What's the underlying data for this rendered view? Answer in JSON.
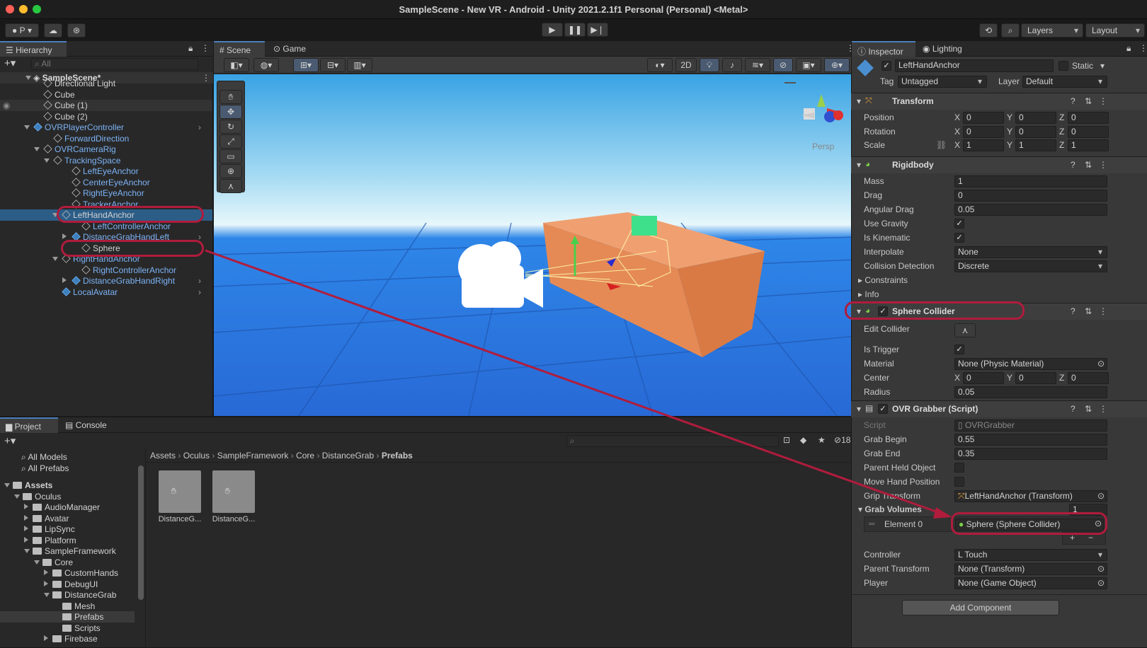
{
  "window": {
    "title": "SampleScene - New VR - Android - Unity 2021.2.1f1 Personal (Personal) <Metal>"
  },
  "toolbar": {
    "account": "P",
    "layers": "Layers",
    "layout": "Layout"
  },
  "hierarchy": {
    "tab": "Hierarchy",
    "search_placeholder": "All",
    "scene": "SampleScene*",
    "items": [
      {
        "label": "Directional Light"
      },
      {
        "label": "Cube"
      },
      {
        "label": "Cube (1)"
      },
      {
        "label": "Cube (2)"
      },
      {
        "label": "OVRPlayerController"
      },
      {
        "label": "ForwardDirection"
      },
      {
        "label": "OVRCameraRig"
      },
      {
        "label": "TrackingSpace"
      },
      {
        "label": "LeftEyeAnchor"
      },
      {
        "label": "CenterEyeAnchor"
      },
      {
        "label": "RightEyeAnchor"
      },
      {
        "label": "TrackerAnchor"
      },
      {
        "label": "LeftHandAnchor"
      },
      {
        "label": "LeftControllerAnchor"
      },
      {
        "label": "DistanceGrabHandLeft"
      },
      {
        "label": "Sphere"
      },
      {
        "label": "RightHandAnchor"
      },
      {
        "label": "RightControllerAnchor"
      },
      {
        "label": "DistanceGrabHandRight"
      },
      {
        "label": "LocalAvatar"
      }
    ]
  },
  "scene_view": {
    "tab_scene": "Scene",
    "tab_game": "Game",
    "mode_2d": "2D",
    "projection": "Persp"
  },
  "project": {
    "tab_project": "Project",
    "tab_console": "Console",
    "hidden_count": "18",
    "favorites": [
      "All Models",
      "All Prefabs"
    ],
    "tree": [
      {
        "label": "Assets"
      },
      {
        "label": "Oculus"
      },
      {
        "label": "AudioManager"
      },
      {
        "label": "Avatar"
      },
      {
        "label": "LipSync"
      },
      {
        "label": "Platform"
      },
      {
        "label": "SampleFramework"
      },
      {
        "label": "Core"
      },
      {
        "label": "CustomHands"
      },
      {
        "label": "DebugUI"
      },
      {
        "label": "DistanceGrab"
      },
      {
        "label": "Mesh"
      },
      {
        "label": "Prefabs"
      },
      {
        "label": "Scripts"
      },
      {
        "label": "Firebase"
      }
    ],
    "breadcrumb": [
      "Assets",
      "Oculus",
      "SampleFramework",
      "Core",
      "DistanceGrab",
      "Prefabs"
    ],
    "assets": [
      {
        "label": "DistanceG..."
      },
      {
        "label": "DistanceG..."
      }
    ]
  },
  "inspector": {
    "tab_inspector": "Inspector",
    "tab_lighting": "Lighting",
    "object_name": "LeftHandAnchor",
    "static_label": "Static",
    "tag_label": "Tag",
    "tag_value": "Untagged",
    "layer_label": "Layer",
    "layer_value": "Default",
    "transform": {
      "title": "Transform",
      "position_label": "Position",
      "position": [
        "0",
        "0",
        "0"
      ],
      "rotation_label": "Rotation",
      "rotation": [
        "0",
        "0",
        "0"
      ],
      "scale_label": "Scale",
      "scale": [
        "1",
        "1",
        "1"
      ]
    },
    "rigidbody": {
      "title": "Rigidbody",
      "mass_label": "Mass",
      "mass": "1",
      "drag_label": "Drag",
      "drag": "0",
      "angular_drag_label": "Angular Drag",
      "angular_drag": "0.05",
      "use_gravity_label": "Use Gravity",
      "is_kinematic_label": "Is Kinematic",
      "interpolate_label": "Interpolate",
      "interpolate": "None",
      "collision_label": "Collision Detection",
      "collision": "Discrete",
      "constraints_label": "Constraints",
      "info_label": "Info"
    },
    "sphere_collider": {
      "title": "Sphere Collider",
      "edit_collider_label": "Edit Collider",
      "is_trigger_label": "Is Trigger",
      "material_label": "Material",
      "material": "None (Physic Material)",
      "center_label": "Center",
      "center": [
        "0",
        "0",
        "0"
      ],
      "radius_label": "Radius",
      "radius": "0.05"
    },
    "ovr_grabber": {
      "title": "OVR Grabber (Script)",
      "script_label": "Script",
      "script": "OVRGrabber",
      "grab_begin_label": "Grab Begin",
      "grab_begin": "0.55",
      "grab_end_label": "Grab End",
      "grab_end": "0.35",
      "parent_held_label": "Parent Held Object",
      "move_hand_label": "Move Hand Position",
      "grip_transform_label": "Grip Transform",
      "grip_transform": "LeftHandAnchor (Transform)",
      "grab_volumes_label": "Grab Volumes",
      "grab_volumes_count": "1",
      "element0_label": "Element 0",
      "element0": "Sphere (Sphere Collider)",
      "controller_label": "Controller",
      "controller": "L Touch",
      "parent_transform_label": "Parent Transform",
      "parent_transform": "None (Transform)",
      "player_label": "Player",
      "player": "None (Game Object)"
    },
    "add_component": "Add Component"
  },
  "axis": {
    "x": "X",
    "y": "Y",
    "z": "Z"
  },
  "colors": {
    "accent": "#4a7ebb",
    "annotation": "#b01c3c",
    "selection": "#2c5d87",
    "hier_blue": "#7cb3f5"
  }
}
